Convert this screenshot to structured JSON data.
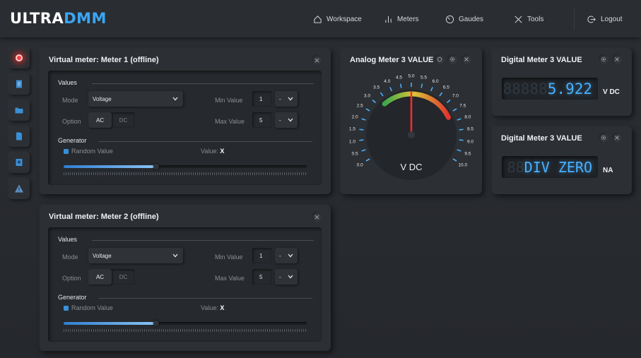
{
  "brand": {
    "part1": "ULTRA",
    "part2": "DMM"
  },
  "nav": {
    "workspace": "Workspace",
    "meters": "Meters",
    "gaudes": "Gaudes",
    "tools": "Tools",
    "logout": "Logout"
  },
  "sidebar": {
    "items": [
      {
        "icon": "record-icon"
      },
      {
        "icon": "document-icon"
      },
      {
        "icon": "folder-icon"
      },
      {
        "icon": "file-icon"
      },
      {
        "icon": "device-icon"
      },
      {
        "icon": "warning-icon"
      }
    ]
  },
  "meter1": {
    "title": "Virtual meter: Meter 1 (offline)",
    "values_label": "Values",
    "mode_label": "Mode",
    "mode_value": "Voltage",
    "option_label": "Option",
    "option_ac": "AC",
    "option_dc": "DC",
    "option_selected": "AC",
    "min_label": "Min Value",
    "min_value": "1",
    "min_spin": "-",
    "max_label": "Max Value",
    "max_value": "5",
    "max_spin": "-",
    "generator_label": "Generator",
    "random_label": "Random Value",
    "random_checked": true,
    "value_label": "Value:",
    "value_text": "X",
    "slider_fraction": 0.38
  },
  "meter2": {
    "title": "Virtual meter: Meter 2 (offline)",
    "values_label": "Values",
    "mode_label": "Mode",
    "mode_value": "Voltage",
    "option_label": "Option",
    "option_ac": "AC",
    "option_dc": "DC",
    "option_selected": "AC",
    "min_label": "Min Value",
    "min_value": "1",
    "min_spin": "-",
    "max_label": "Max Value",
    "max_value": "5",
    "max_spin": "-",
    "generator_label": "Generator",
    "random_label": "Random Value",
    "random_checked": true,
    "value_label": "Value:",
    "value_text": "X",
    "slider_fraction": 0.38
  },
  "analog": {
    "title": "Analog Meter 3 VALUE",
    "unit": "V DC",
    "value": 5.0,
    "min": 0.0,
    "max": 10.0,
    "scale_labels": [
      "0.0",
      "0.5",
      "1.0",
      "1.5",
      "2.0",
      "2.5",
      "3.0",
      "3.5",
      "4.0",
      "4.5",
      "5.0",
      "5.5",
      "6.0",
      "6.5",
      "7.0",
      "7.5",
      "8.0",
      "8.5",
      "9.0",
      "9.5",
      "10.0"
    ]
  },
  "digital1": {
    "title": "Digital Meter 3 VALUE",
    "ghost": "88888",
    "reading": "5.922",
    "unit": "V DC"
  },
  "digital2": {
    "title": "Digital Meter 3 VALUE",
    "ghost": "88",
    "reading": "DIV ZERO",
    "unit": "NA"
  },
  "colors": {
    "accent": "#3aa6f5",
    "lcd_lit": "#49b0ff",
    "record": "#ff3b3b",
    "needle": "#ff2a2a"
  }
}
